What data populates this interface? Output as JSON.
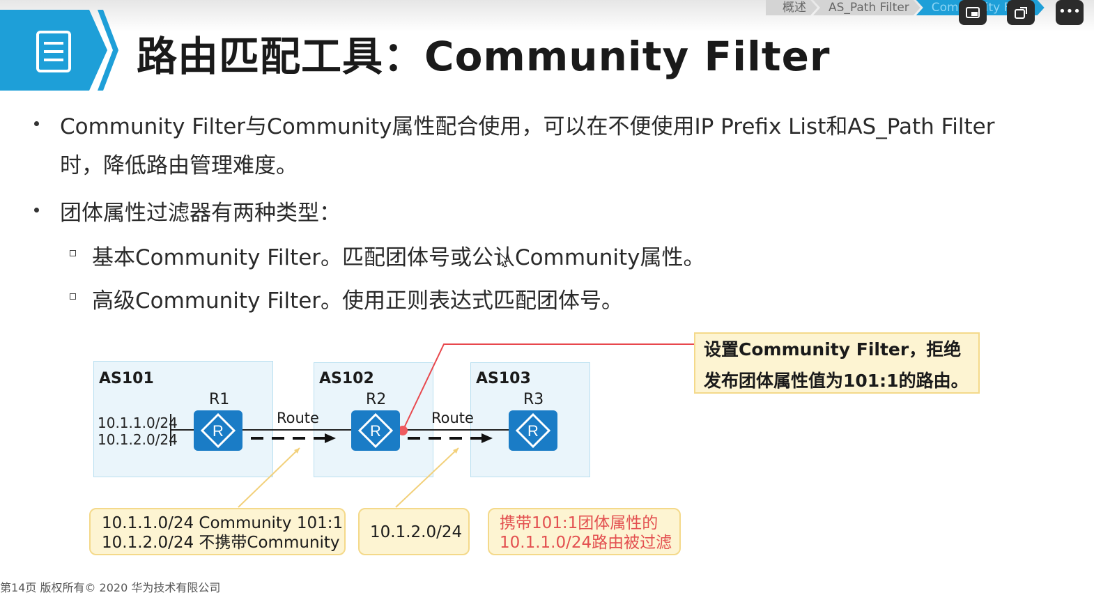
{
  "breadcrumb": [
    "概述",
    "AS_Path Filter",
    "Community Filter"
  ],
  "window_controls": {
    "ctrl1": "⎇",
    "ctrl2": "⧉",
    "ctrl3": "•••"
  },
  "title": "路由匹配工具：Community Filter",
  "bullets": {
    "b1_line1": "Community  Filter与Community属性配合使用，可以在不便使用IP  Prefix  List和AS_Path  Filter",
    "b1_line2": "时，降低路由管理难度。",
    "b2": "团体属性过滤器有两种类型：",
    "sub1": "基本Community Filter。匹配团体号或公认Community属性。",
    "sub2": "高级Community Filter。使用正则表达式匹配团体号。"
  },
  "diagram": {
    "as101": "AS101",
    "as102": "AS102",
    "as103": "AS103",
    "r1": "R1",
    "r2": "R2",
    "r3": "R3",
    "route1": "Route",
    "route2": "Route",
    "prefix1": "10.1.1.0/24",
    "prefix2": "10.1.2.0/24",
    "callout_line1": "设置Community  Filter，拒绝",
    "callout_line2": "发布团体属性值为101:1的路由。",
    "note1_line1": "10.1.1.0/24 Community 101:1",
    "note1_line2": "10.1.2.0/24 不携带Community",
    "note2": "10.1.2.0/24",
    "note3_line1": "携带101:1团体属性的",
    "note3_line2": "10.1.1.0/24路由被过滤"
  },
  "footer": "第14页    版权所有© 2020 华为技术有限公司",
  "colors": {
    "accent": "#1e9fd8",
    "router": "#1a7cc6",
    "callout_line": "#e8484d",
    "note_red": "#e35050"
  }
}
